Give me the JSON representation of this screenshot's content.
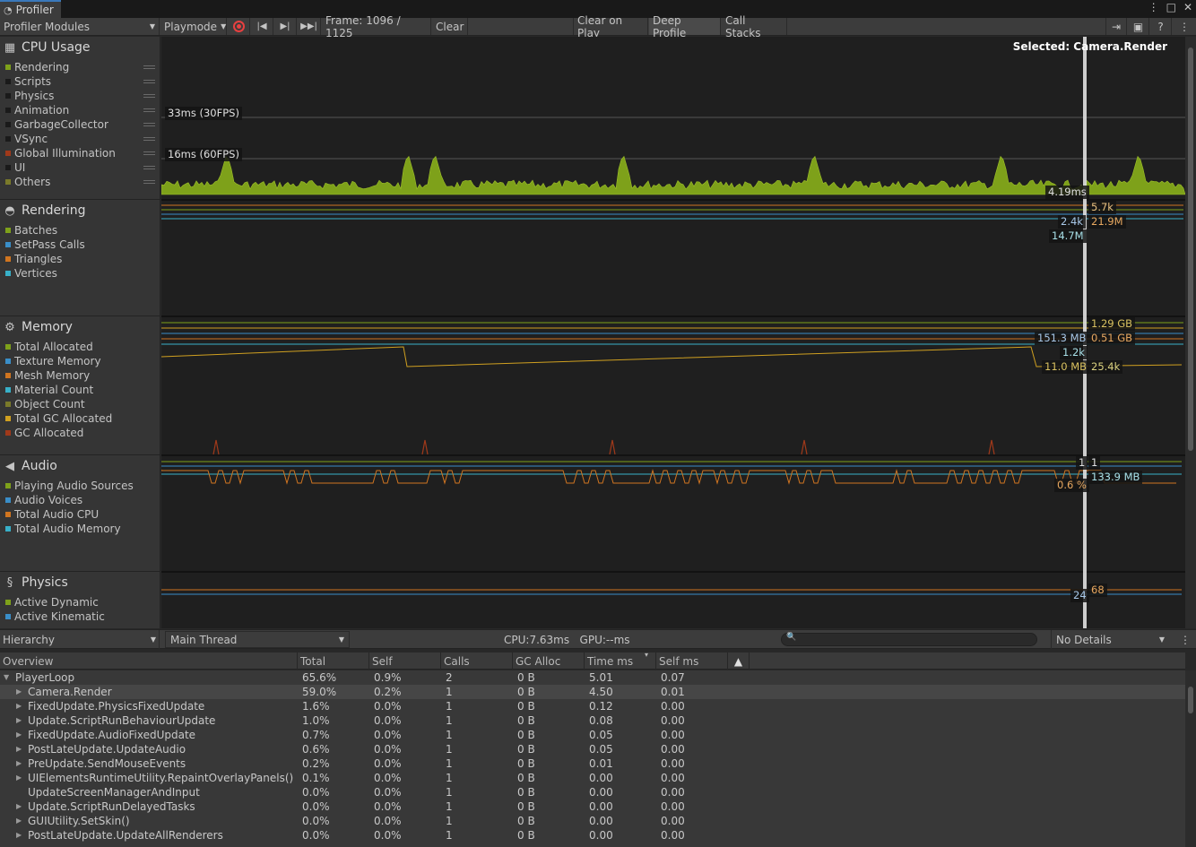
{
  "window": {
    "title": "Profiler"
  },
  "toolbar": {
    "modules_label": "Profiler Modules",
    "playmode_label": "Playmode",
    "frame_text": "Frame: 1096 / 1125",
    "clear_label": "Clear",
    "clear_on_play_label": "Clear on Play",
    "deep_profile_label": "Deep Profile",
    "call_stacks_label": "Call Stacks"
  },
  "modules": {
    "cpu": {
      "title": "CPU Usage",
      "items": [
        {
          "label": "Rendering",
          "color": "#7ea11a"
        },
        {
          "label": "Scripts",
          "color": "#1a1a1a"
        },
        {
          "label": "Physics",
          "color": "#1a1a1a"
        },
        {
          "label": "Animation",
          "color": "#1a1a1a"
        },
        {
          "label": "GarbageCollector",
          "color": "#1a1a1a"
        },
        {
          "label": "VSync",
          "color": "#1a1a1a"
        },
        {
          "label": "Global Illumination",
          "color": "#a0391a"
        },
        {
          "label": "UI",
          "color": "#1a1a1a"
        },
        {
          "label": "Others",
          "color": "#7a7a2a"
        }
      ]
    },
    "rendering": {
      "title": "Rendering",
      "items": [
        {
          "label": "Batches",
          "color": "#7ea11a"
        },
        {
          "label": "SetPass Calls",
          "color": "#3a8ec8"
        },
        {
          "label": "Triangles",
          "color": "#d07520"
        },
        {
          "label": "Vertices",
          "color": "#38b0c8"
        }
      ]
    },
    "memory": {
      "title": "Memory",
      "items": [
        {
          "label": "Total Allocated",
          "color": "#7ea11a"
        },
        {
          "label": "Texture Memory",
          "color": "#3a8ec8"
        },
        {
          "label": "Mesh Memory",
          "color": "#d07520"
        },
        {
          "label": "Material Count",
          "color": "#38b0c8"
        },
        {
          "label": "Object Count",
          "color": "#7a7a2a"
        },
        {
          "label": "Total GC Allocated",
          "color": "#d0a020"
        },
        {
          "label": "GC Allocated",
          "color": "#a0391a"
        }
      ]
    },
    "audio": {
      "title": "Audio",
      "items": [
        {
          "label": "Playing Audio Sources",
          "color": "#7ea11a"
        },
        {
          "label": "Audio Voices",
          "color": "#3a8ec8"
        },
        {
          "label": "Total Audio CPU",
          "color": "#d07520"
        },
        {
          "label": "Total Audio Memory",
          "color": "#38b0c8"
        }
      ]
    },
    "physics": {
      "title": "Physics",
      "items": [
        {
          "label": "Active Dynamic",
          "color": "#7ea11a"
        },
        {
          "label": "Active Kinematic",
          "color": "#3a8ec8"
        }
      ]
    }
  },
  "graph": {
    "selected_text": "Selected: Camera.Render",
    "cpu_line_30": "33ms (30FPS)",
    "cpu_line_60": "16ms (60FPS)",
    "cpu_value": "4.19ms",
    "rendering_values": [
      "5.7k",
      "2.4k",
      "21.9M",
      "14.7M"
    ],
    "memory_values": [
      "1.29 GB",
      "151.3 MB",
      "0.51 GB",
      "1.2k",
      "11.0 MB",
      "25.4k"
    ],
    "audio_values": [
      "1",
      "1",
      "133.9 MB",
      "0.6 %"
    ],
    "physics_values": [
      "68",
      "24"
    ]
  },
  "hierarchy": {
    "view_label": "Hierarchy",
    "thread_label": "Main Thread",
    "cpu_gpu_text": "CPU:7.63ms   GPU:--ms",
    "details_label": "No Details",
    "columns": [
      "Overview",
      "Total",
      "Self",
      "Calls",
      "GC Alloc",
      "Time ms",
      "Self ms"
    ],
    "rows": [
      {
        "name": "PlayerLoop",
        "total": "65.6%",
        "self": "0.9%",
        "calls": "2",
        "gc": "0 B",
        "time": "5.01",
        "selfms": "0.07",
        "level": 0,
        "expanded": true
      },
      {
        "name": "Camera.Render",
        "total": "59.0%",
        "self": "0.2%",
        "calls": "1",
        "gc": "0 B",
        "time": "4.50",
        "selfms": "0.01",
        "level": 1,
        "selected": true
      },
      {
        "name": "FixedUpdate.PhysicsFixedUpdate",
        "total": "1.6%",
        "self": "0.0%",
        "calls": "1",
        "gc": "0 B",
        "time": "0.12",
        "selfms": "0.00",
        "level": 1
      },
      {
        "name": "Update.ScriptRunBehaviourUpdate",
        "total": "1.0%",
        "self": "0.0%",
        "calls": "1",
        "gc": "0 B",
        "time": "0.08",
        "selfms": "0.00",
        "level": 1
      },
      {
        "name": "FixedUpdate.AudioFixedUpdate",
        "total": "0.7%",
        "self": "0.0%",
        "calls": "1",
        "gc": "0 B",
        "time": "0.05",
        "selfms": "0.00",
        "level": 1
      },
      {
        "name": "PostLateUpdate.UpdateAudio",
        "total": "0.6%",
        "self": "0.0%",
        "calls": "1",
        "gc": "0 B",
        "time": "0.05",
        "selfms": "0.00",
        "level": 1
      },
      {
        "name": "PreUpdate.SendMouseEvents",
        "total": "0.2%",
        "self": "0.0%",
        "calls": "1",
        "gc": "0 B",
        "time": "0.01",
        "selfms": "0.00",
        "level": 1
      },
      {
        "name": "UIElementsRuntimeUtility.RepaintOverlayPanels()",
        "total": "0.1%",
        "self": "0.0%",
        "calls": "1",
        "gc": "0 B",
        "time": "0.00",
        "selfms": "0.00",
        "level": 1
      },
      {
        "name": "UpdateScreenManagerAndInput",
        "total": "0.0%",
        "self": "0.0%",
        "calls": "1",
        "gc": "0 B",
        "time": "0.00",
        "selfms": "0.00",
        "level": 1,
        "leaf": true
      },
      {
        "name": "Update.ScriptRunDelayedTasks",
        "total": "0.0%",
        "self": "0.0%",
        "calls": "1",
        "gc": "0 B",
        "time": "0.00",
        "selfms": "0.00",
        "level": 1
      },
      {
        "name": "GUIUtility.SetSkin()",
        "total": "0.0%",
        "self": "0.0%",
        "calls": "1",
        "gc": "0 B",
        "time": "0.00",
        "selfms": "0.00",
        "level": 1
      },
      {
        "name": "PostLateUpdate.UpdateAllRenderers",
        "total": "0.0%",
        "self": "0.0%",
        "calls": "1",
        "gc": "0 B",
        "time": "0.00",
        "selfms": "0.00",
        "level": 1
      }
    ]
  }
}
